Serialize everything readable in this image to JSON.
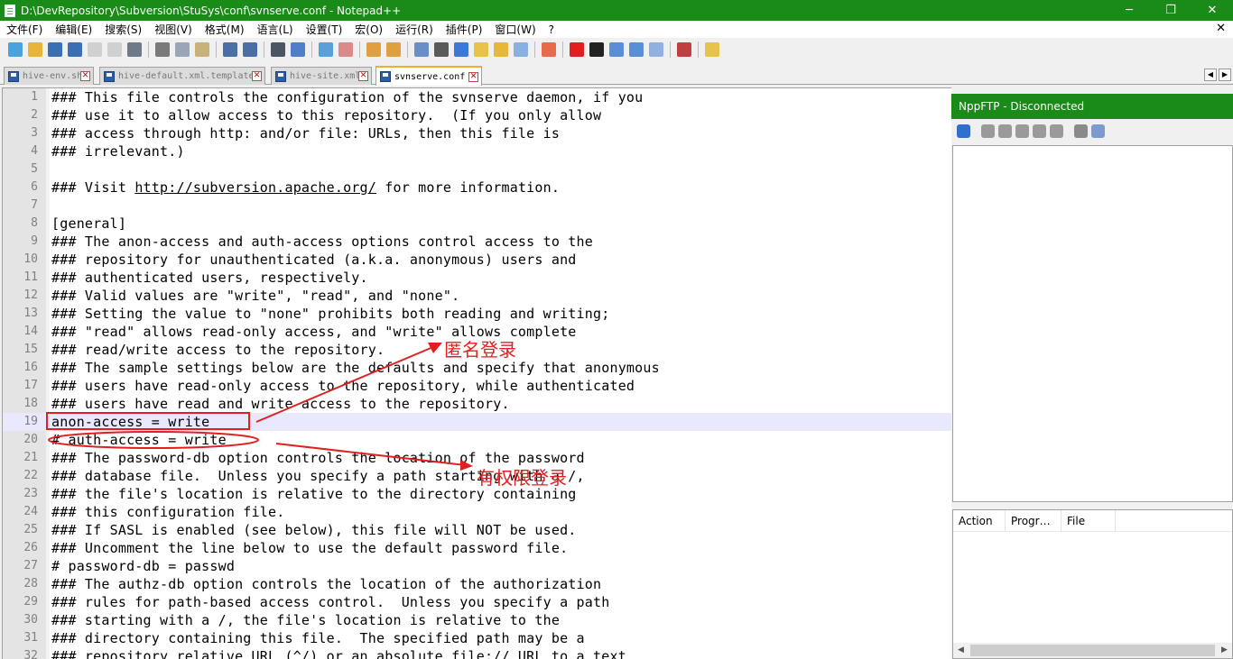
{
  "window": {
    "title": "D:\\DevRepository\\Subversion\\StuSys\\conf\\svnserve.conf - Notepad++",
    "minimize": "─",
    "maximize": "❐",
    "close": "✕"
  },
  "menu": {
    "items": [
      "文件(F)",
      "编辑(E)",
      "搜索(S)",
      "视图(V)",
      "格式(M)",
      "语言(L)",
      "设置(T)",
      "宏(O)",
      "运行(R)",
      "插件(P)",
      "窗口(W)",
      "?"
    ],
    "close_doc": "✕"
  },
  "toolbar": {
    "icons": [
      "new-file-icon",
      "open-file-icon",
      "save-icon",
      "save-all-icon",
      "close-icon",
      "close-all-icon",
      "print-icon",
      "cut-icon",
      "copy-icon",
      "paste-icon",
      "undo-icon",
      "redo-icon",
      "find-icon",
      "replace-icon",
      "zoom-in-icon",
      "zoom-out-icon",
      "sync-vertical-icon",
      "sync-horizontal-icon",
      "word-wrap-icon",
      "show-all-chars-icon",
      "indent-guide-icon",
      "udl-icon",
      "doc-map-icon",
      "function-list-icon",
      "folder-workspace-icon",
      "record-macro-icon",
      "stop-macro-icon",
      "play-macro-icon",
      "run-macro-multiple-icon",
      "save-macro-icon",
      "spell-check-icon",
      "nppftp-icon"
    ],
    "colors": [
      "#4aa3df",
      "#e8b43a",
      "#3b6fb5",
      "#3b6fb5",
      "#d0d0d0",
      "#d0d0d0",
      "#6e7a88",
      "#7a7a7a",
      "#9aa5b5",
      "#c9b27a",
      "#4a6fa5",
      "#4a6fa5",
      "#4b5563",
      "#4f7fc7",
      "#5aa0d8",
      "#d98a8a",
      "#e0a040",
      "#e0a040",
      "#6a8fc8",
      "#5a5a5a",
      "#3c78d8",
      "#e8c34a",
      "#e8b73a",
      "#8ab0e0",
      "#e86a4a",
      "#e02020",
      "#222222",
      "#5a8fd8",
      "#5a8fd8",
      "#8fb0e0",
      "#c04040",
      "#e8c34a"
    ]
  },
  "tabs": [
    {
      "label": "hive-env.sh",
      "active": false
    },
    {
      "label": "hive-default.xml.template",
      "active": false
    },
    {
      "label": "hive-site.xml",
      "active": false
    },
    {
      "label": "svnserve.conf",
      "active": true
    }
  ],
  "tab_scroll": {
    "left": "◀",
    "right": "▶"
  },
  "editor": {
    "current_line": 19,
    "lines": [
      "### This file controls the configuration of the svnserve daemon, if you",
      "### use it to allow access to this repository.  (If you only allow",
      "### access through http: and/or file: URLs, then this file is",
      "### irrelevant.)",
      "",
      "### Visit |http://subversion.apache.org/| for more information.",
      "",
      "[general]",
      "### The anon-access and auth-access options control access to the",
      "### repository for unauthenticated (a.k.a. anonymous) users and",
      "### authenticated users, respectively.",
      "### Valid values are \"write\", \"read\", and \"none\".",
      "### Setting the value to \"none\" prohibits both reading and writing;",
      "### \"read\" allows read-only access, and \"write\" allows complete",
      "### read/write access to the repository.",
      "### The sample settings below are the defaults and specify that anonymous",
      "### users have read-only access to the repository, while authenticated",
      "### users have read and write access to the repository.",
      "anon-access = write",
      "# auth-access = write",
      "### The password-db option controls the location of the password",
      "### database file.  Unless you specify a path starting with a /,",
      "### the file's location is relative to the directory containing",
      "### this configuration file.",
      "### If SASL is enabled (see below), this file will NOT be used.",
      "### Uncomment the line below to use the default password file.",
      "# password-db = passwd",
      "### The authz-db option controls the location of the authorization",
      "### rules for path-based access control.  Unless you specify a path",
      "### starting with a /, the file's location is relative to the",
      "### directory containing this file.  The specified path may be a",
      "### repository relative URL (^/) or an absolute file:// URL to a text"
    ]
  },
  "annotations": {
    "anon_label": "匿名登录",
    "auth_label": "有权限登录",
    "color": "#e02020"
  },
  "ftp": {
    "title": "NppFTP - Disconnected",
    "tool_icons": [
      "connect-icon",
      "disconnect-icon",
      "download-icon",
      "upload-icon",
      "refresh-icon",
      "abort-icon",
      "settings-icon",
      "message-window-icon"
    ],
    "tool_colors": [
      "#2f6fd0",
      "#9a9a9a",
      "#9a9a9a",
      "#9a9a9a",
      "#9a9a9a",
      "#9a9a9a",
      "#8a8a8a",
      "#7a9ad0"
    ],
    "queue_columns": [
      {
        "label": "Action"
      },
      {
        "label": "Progr…"
      },
      {
        "label": "File"
      }
    ],
    "scroll_left": "◀",
    "scroll_right": "▶"
  }
}
